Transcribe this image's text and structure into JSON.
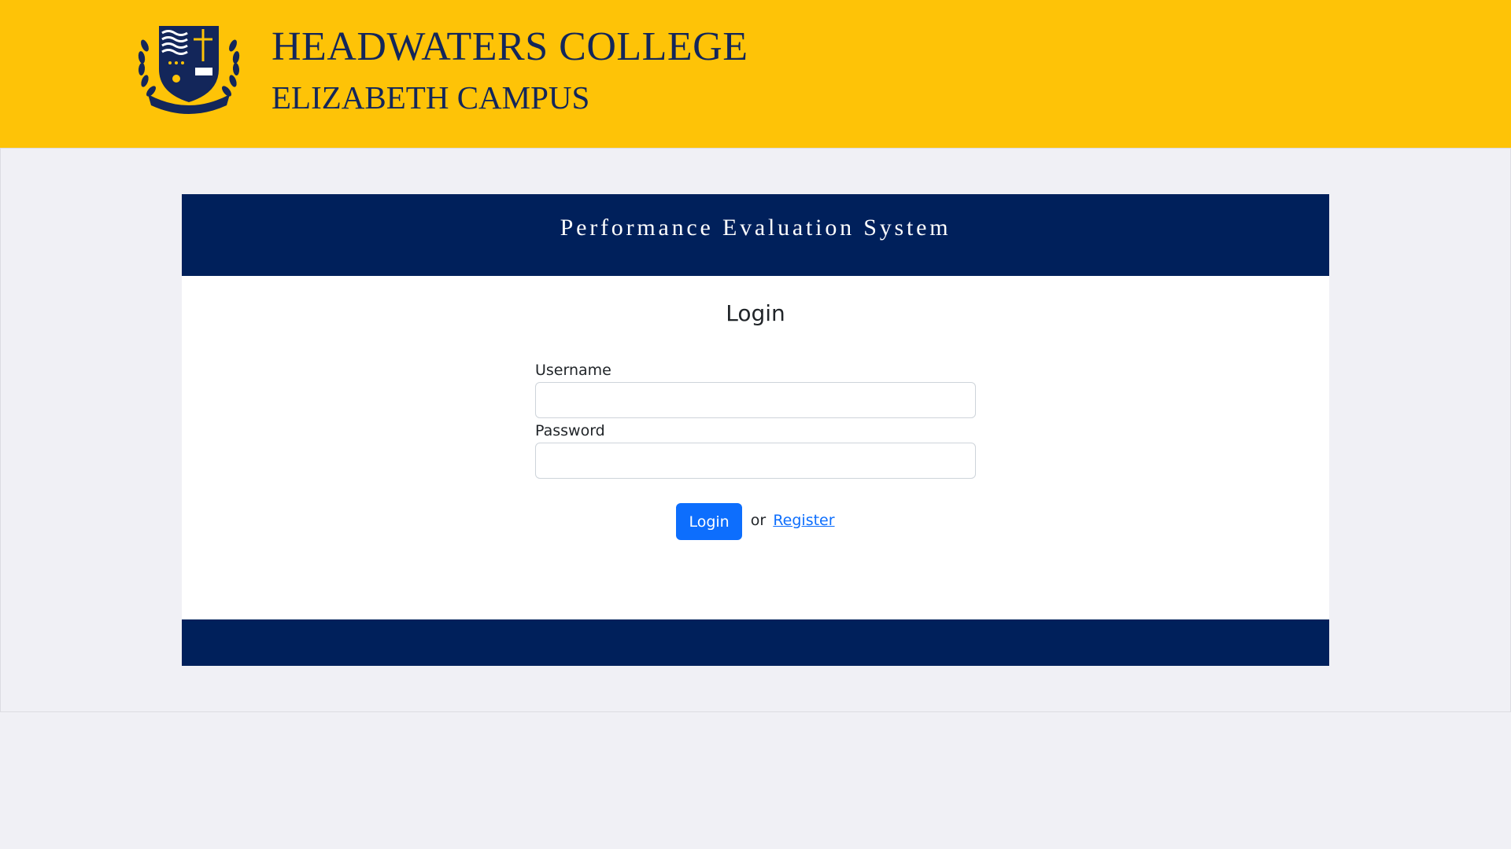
{
  "header": {
    "college_name": "HEADWATERS COLLEGE",
    "campus_name": "ELIZABETH CAMPUS",
    "crest_text": "HEADWATERS COLLEGE",
    "brand_color": "#fec307",
    "text_color": "#13265a"
  },
  "card": {
    "system_title": "Performance Evaluation System",
    "header_color": "#00205b"
  },
  "login": {
    "heading": "Login",
    "username_label": "Username",
    "username_value": "",
    "password_label": "Password",
    "password_value": "",
    "login_button": "Login",
    "or_text": "or",
    "register_link": "Register",
    "accent_color": "#0d6efd"
  }
}
